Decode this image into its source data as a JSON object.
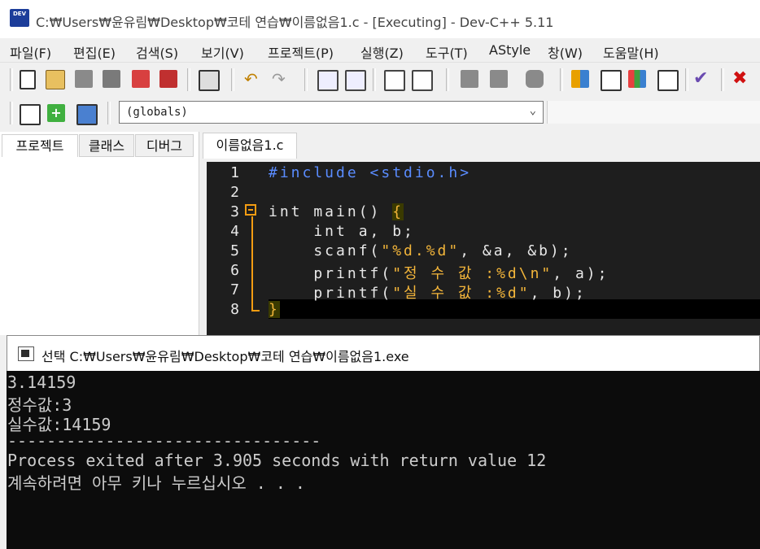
{
  "window": {
    "title": "C:₩Users₩윤유림₩Desktop₩코테 연습₩이름없음1.c - [Executing] - Dev-C++ 5.11",
    "icon_text": "DEV"
  },
  "menu": [
    "파일(F)",
    "편집(E)",
    "검색(S)",
    "보기(V)",
    "프로젝트(P)",
    "실행(Z)",
    "도구(T)",
    "AStyle",
    "창(W)",
    "도움말(H)"
  ],
  "scope_select": {
    "value": "(globals)"
  },
  "left_tabs": [
    "프로젝트",
    "클래스",
    "디버그"
  ],
  "editor": {
    "tab_label": "이름없음1.c",
    "line_numbers": [
      "1",
      "2",
      "3",
      "4",
      "5",
      "6",
      "7",
      "8"
    ],
    "lines": [
      "#include <stdio.h>",
      "",
      "int main() {",
      "    int a, b;",
      "    scanf(\"%d.%d\", &a, &b);",
      "    printf(\"정 수 값 :%d\\n\", a);",
      "    printf(\"실 수 값 :%d\", b);",
      "}"
    ]
  },
  "console": {
    "title": "선택 C:₩Users₩윤유림₩Desktop₩코테 연습₩이름없음1.exe",
    "lines": [
      "3.14159",
      "정수값:3",
      "실수값:14159",
      "--------------------------------",
      "Process exited after 3.905 seconds with return value 12",
      "계속하려면 아무 키나 누르십시오 . . ."
    ]
  },
  "colors": {
    "editor_bg": "#1e1e1e",
    "keyword": "#5a8cff",
    "string": "#f3b53a",
    "fold_marker": "#f39c12",
    "console_bg": "#0c0c0c",
    "console_text": "#cccccc"
  },
  "toolbar_icons": [
    "new-file-icon",
    "open-file-icon",
    "save-icon",
    "save-all-icon",
    "close-icon",
    "close-all-icon",
    "print-icon",
    "undo-icon",
    "redo-icon",
    "find-icon",
    "replace-icon",
    "goto-line-icon",
    "goto-function-icon",
    "indent-icon",
    "unindent-icon",
    "comment-icon",
    "compile-icon",
    "run-icon",
    "compile-run-icon",
    "rebuild-icon",
    "check-icon",
    "stop-icon",
    "new-project-icon",
    "add-file-icon",
    "remove-file-icon"
  ]
}
